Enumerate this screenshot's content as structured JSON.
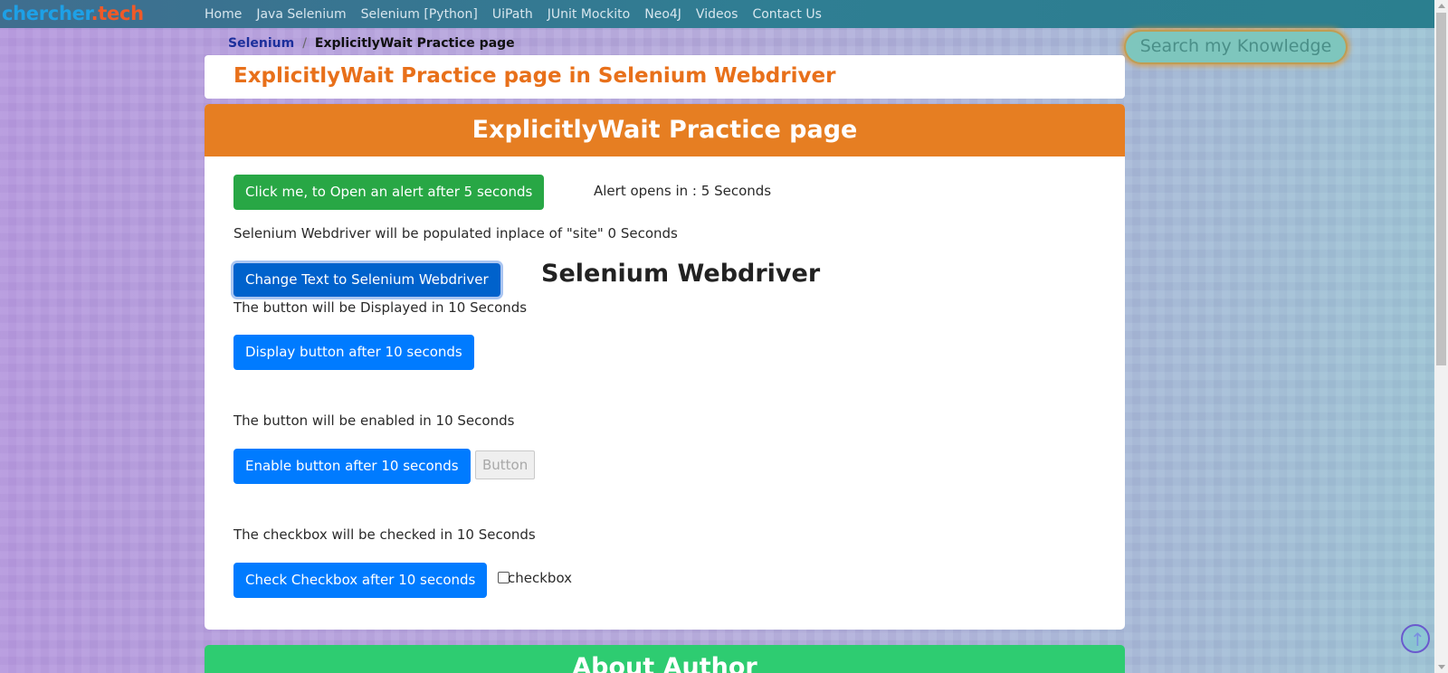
{
  "logo": {
    "part1": "chercher",
    "dot": ".",
    "part2": "tech"
  },
  "nav": {
    "items": [
      {
        "label": "Home"
      },
      {
        "label": "Java Selenium"
      },
      {
        "label": "Selenium [Python]"
      },
      {
        "label": "UiPath"
      },
      {
        "label": "JUnit Mockito"
      },
      {
        "label": "Neo4J"
      },
      {
        "label": "Videos"
      },
      {
        "label": "Contact Us"
      }
    ]
  },
  "breadcrumb": {
    "parent": "Selenium",
    "separator": "/",
    "current": "ExplicitlyWait Practice page"
  },
  "search": {
    "label": "Search my Knowledge"
  },
  "page_title": "ExplicitlyWait Practice page in Selenium Webdriver",
  "main": {
    "header": "ExplicitlyWait Practice page",
    "alert_button": "Click me, to Open an alert after 5 seconds",
    "alert_text": "Alert opens in : 5 Seconds",
    "populate_text": "Selenium Webdriver will be populated inplace of \"site\" 0 Seconds",
    "change_text_button": "Change Text to Selenium Webdriver",
    "changed_text": "Selenium Webdriver",
    "display_text": "The button will be Displayed in 10 Seconds",
    "display_button": "Display button after 10 seconds",
    "enable_text": "The button will be enabled in 10 Seconds",
    "enable_button": "Enable button after 10 seconds",
    "disabled_button": "Button",
    "checkbox_text": "The checkbox will be checked in 10 Seconds",
    "checkbox_button": "Check Checkbox after 10 seconds",
    "checkbox_label": "checkbox",
    "checkbox_checked": false
  },
  "about": {
    "header": "About Author"
  },
  "icons": {
    "back_to_top": "arrow-up-icon"
  },
  "colors": {
    "accent_orange": "#e67e22",
    "title_orange": "#e8701a",
    "primary_blue": "#007bff",
    "success_green": "#28a745",
    "about_green": "#2ecc71"
  }
}
